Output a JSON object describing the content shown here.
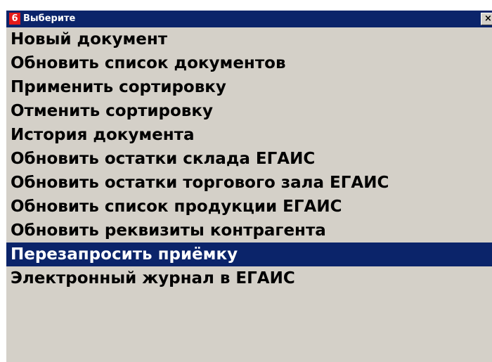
{
  "dialog": {
    "app_badge": "6",
    "title": "Выберите",
    "close_label": "×",
    "colors": {
      "titlebar": "#0b246a",
      "badge": "#e41a1a",
      "background": "#d4d0c8",
      "selection": "#0b246a"
    }
  },
  "menu": {
    "selected_index": 10,
    "items": [
      {
        "label": "Новый документ"
      },
      {
        "label": "Обновить список документов"
      },
      {
        "label": "Применить сортировку"
      },
      {
        "label": "Отменить сортировку"
      },
      {
        "label": "История документа"
      },
      {
        "label": "Обновить остатки склада ЕГАИС"
      },
      {
        "label": "Обновить остатки торгового зала ЕГАИС"
      },
      {
        "label": "Обновить список продукции ЕГАИС"
      },
      {
        "label": "Обновить реквизиты контрагента"
      },
      {
        "label": "Перезапросить приёмку"
      },
      {
        "label": "Электронный журнал в ЕГАИС"
      }
    ]
  }
}
